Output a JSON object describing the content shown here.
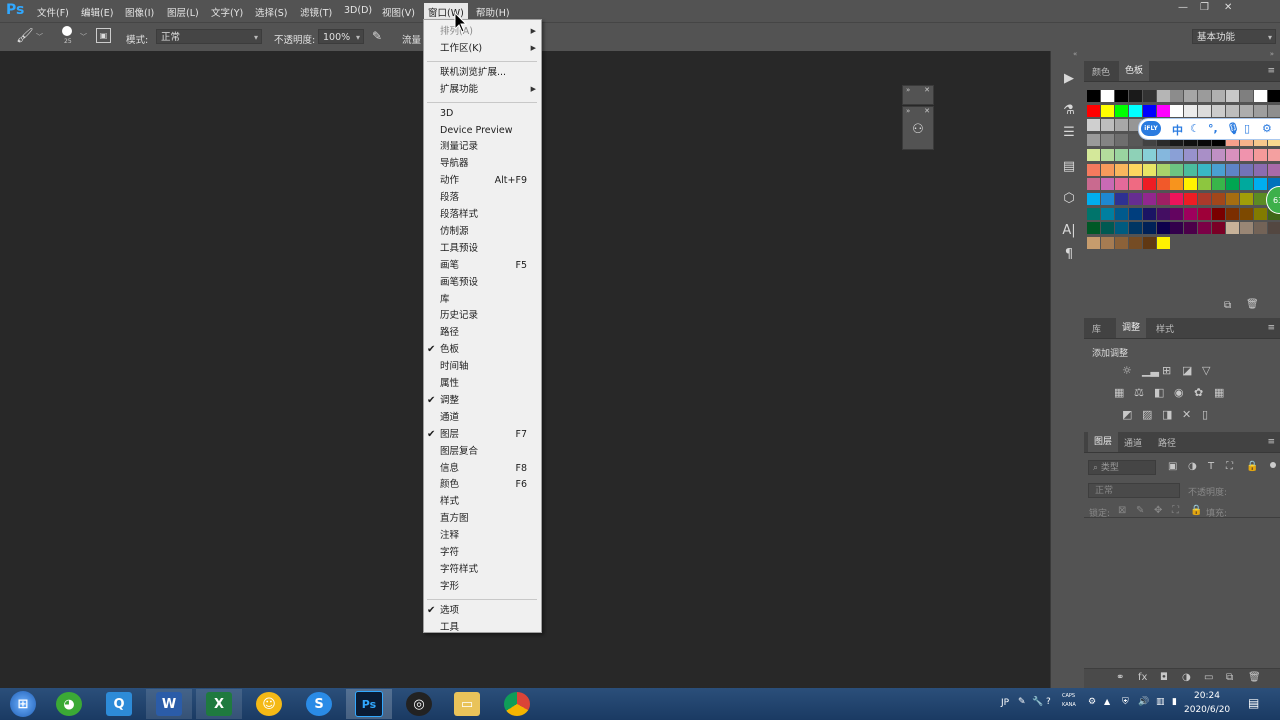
{
  "app": {
    "logo": "Ps"
  },
  "menubar": {
    "items": [
      "文件(F)",
      "编辑(E)",
      "图像(I)",
      "图层(L)",
      "文字(Y)",
      "选择(S)",
      "滤镜(T)",
      "3D(D)",
      "视图(V)",
      "窗口(W)",
      "帮助(H)"
    ],
    "active_index": 9
  },
  "window_controls": {
    "minimize": "—",
    "restore": "❐",
    "close": "✕"
  },
  "options": {
    "brush_size": "25",
    "mode_label": "模式:",
    "mode_value": "正常",
    "opacity_label": "不透明度:",
    "opacity_value": "100%",
    "flow_label": "流量",
    "workspace": "基本功能"
  },
  "window_menu": {
    "items": [
      {
        "label": "排列(A)",
        "submenu": true,
        "gray": true
      },
      {
        "label": "工作区(K)",
        "submenu": true
      },
      {
        "sep": true
      },
      {
        "label": "联机浏览扩展..."
      },
      {
        "label": "扩展功能",
        "submenu": true
      },
      {
        "sep": true
      },
      {
        "label": "3D"
      },
      {
        "label": "Device Preview"
      },
      {
        "label": "测量记录"
      },
      {
        "label": "导航器"
      },
      {
        "label": "动作",
        "shortcut": "Alt+F9"
      },
      {
        "label": "段落"
      },
      {
        "label": "段落样式"
      },
      {
        "label": "仿制源"
      },
      {
        "label": "工具预设"
      },
      {
        "label": "画笔",
        "shortcut": "F5"
      },
      {
        "label": "画笔预设"
      },
      {
        "label": "库"
      },
      {
        "label": "历史记录"
      },
      {
        "label": "路径"
      },
      {
        "label": "色板",
        "checked": true
      },
      {
        "label": "时间轴"
      },
      {
        "label": "属性"
      },
      {
        "label": "调整",
        "checked": true
      },
      {
        "label": "通道"
      },
      {
        "label": "图层",
        "checked": true,
        "shortcut": "F7"
      },
      {
        "label": "图层复合"
      },
      {
        "label": "信息",
        "shortcut": "F8"
      },
      {
        "label": "颜色",
        "shortcut": "F6"
      },
      {
        "label": "样式"
      },
      {
        "label": "直方图"
      },
      {
        "label": "注释"
      },
      {
        "label": "字符"
      },
      {
        "label": "字符样式"
      },
      {
        "label": "字形"
      },
      {
        "sep": true
      },
      {
        "label": "选项",
        "checked": true
      },
      {
        "label": "工具"
      }
    ]
  },
  "swatches_panel": {
    "tabs": [
      "颜色",
      "色板"
    ],
    "active": 1,
    "colors": [
      [
        "#000000",
        "#ffffff",
        "#000000",
        "#1a1a1a",
        "#333333",
        "#b5b5b5",
        "#8c8c8c",
        "#a6a6a6",
        "#9b9b9b",
        "#b0b0b0",
        "#c8c8c8",
        "#7f7f7f",
        "#ffffff",
        "#000000",
        "#ffffff"
      ],
      [
        "#ff0000",
        "#ffff00",
        "#00ff00",
        "#00ffff",
        "#0000ff",
        "#ff00ff",
        "#ffffff",
        "#ececec",
        "#dcdcdc",
        "#cccccc",
        "#bdbdbd",
        "#adadad",
        "#9e9e9e",
        "#8e8e8e",
        "#7f7f7f"
      ],
      [
        "#cfcfcf",
        "#bdbdbd",
        "#a8a8a8",
        "#969696",
        "#848484",
        "#727272",
        "#606060",
        "#4e4e4e",
        "#3c3c3c",
        "#2a2a2a",
        "#9a9a9a",
        "#8a8a8a",
        "#7a7a7a",
        "#6a6a6a",
        "#5a5a5a"
      ],
      [
        "#9a9a9a",
        "#848484",
        "#6e6e6e",
        "#585858",
        "#424242",
        "#2c2c2c",
        "#1a1a1a",
        "#101010",
        "#080808",
        "#000000",
        "#f7a08b",
        "#f6b38b",
        "#f7c78c",
        "#f9d98e",
        "#fbf08f"
      ],
      [
        "#d4e89a",
        "#b3dc9c",
        "#9ad4a0",
        "#8ed1b7",
        "#87cfd7",
        "#85b7dd",
        "#8aa0d6",
        "#9892cc",
        "#a98fc7",
        "#c090c4",
        "#d991be",
        "#f093ad",
        "#f59a9a",
        "#f4a0a0",
        "#eea4b4"
      ],
      [
        "#f47a5e",
        "#f79a5c",
        "#fab65d",
        "#fdd65f",
        "#e8e566",
        "#a8d26b",
        "#6cc482",
        "#4bbc9e",
        "#39b8c5",
        "#4aa0d2",
        "#5e84c6",
        "#7373b8",
        "#8b6cb0",
        "#a96aa9",
        "#c86aa0"
      ],
      [
        "#c96a8f",
        "#c96ab5",
        "#e36a9a",
        "#ef6a82",
        "#ee1d24",
        "#f1592a",
        "#f7941d",
        "#fff200",
        "#8dc63f",
        "#39b54a",
        "#00a651",
        "#00a99d",
        "#00aeef",
        "#0072bc",
        "#0054a6"
      ],
      [
        "#00aeef",
        "#1e88d2",
        "#2e3192",
        "#662d91",
        "#92278f",
        "#9e1f63",
        "#ed145b",
        "#ee1d24",
        "#ab3a2b",
        "#a2471b",
        "#a66d11",
        "#a19e08",
        "#5c8b23",
        "#1e7a3b",
        "#00744d"
      ],
      [
        "#00746b",
        "#007fa0",
        "#005a8d",
        "#003e7e",
        "#1b1464",
        "#440e62",
        "#630460",
        "#9e005d",
        "#9e0039",
        "#790000",
        "#7b2e00",
        "#7d4900",
        "#827b00",
        "#406618",
        "#005e20"
      ],
      [
        "#005826",
        "#005952",
        "#005b7f",
        "#003663",
        "#002157",
        "#0d004c",
        "#32004b",
        "#4b0049",
        "#7b0046",
        "#7a0026",
        "#c7b299",
        "#998675",
        "#736357",
        "#534741",
        "#37302d"
      ],
      [
        "#c69c6d",
        "#a67c52",
        "#8c6239",
        "#754c24",
        "#603813",
        "#fff200"
      ]
    ]
  },
  "adjust_panel": {
    "tabs": [
      "库",
      "调整",
      "样式"
    ],
    "active": 1,
    "title": "添加调整"
  },
  "layers_panel": {
    "tabs": [
      "图层",
      "通道",
      "路径"
    ],
    "active": 0,
    "filter_placeholder": "类型",
    "blend": "正常",
    "opacity_label": "不透明度:",
    "lock_label": "锁定:",
    "fill_label": "填充:"
  },
  "ifly": {
    "logo": "iFLY",
    "lang": "中"
  },
  "taskbar": {
    "apps": [
      {
        "name": "start",
        "label": ""
      },
      {
        "name": "360",
        "label": ""
      },
      {
        "name": "qq",
        "label": "Q"
      },
      {
        "name": "word",
        "label": "W"
      },
      {
        "name": "excel",
        "label": "X"
      },
      {
        "name": "qq-browser",
        "label": ""
      },
      {
        "name": "sogou",
        "label": "S"
      },
      {
        "name": "photoshop",
        "label": "Ps"
      },
      {
        "name": "obs",
        "label": ""
      },
      {
        "name": "explorer",
        "label": ""
      },
      {
        "name": "chrome",
        "label": ""
      }
    ],
    "tray_lang": "JP",
    "caps": "CAPS",
    "kana": "KANA",
    "time": "20:24",
    "date": "2020/6/20"
  },
  "badge": "63"
}
